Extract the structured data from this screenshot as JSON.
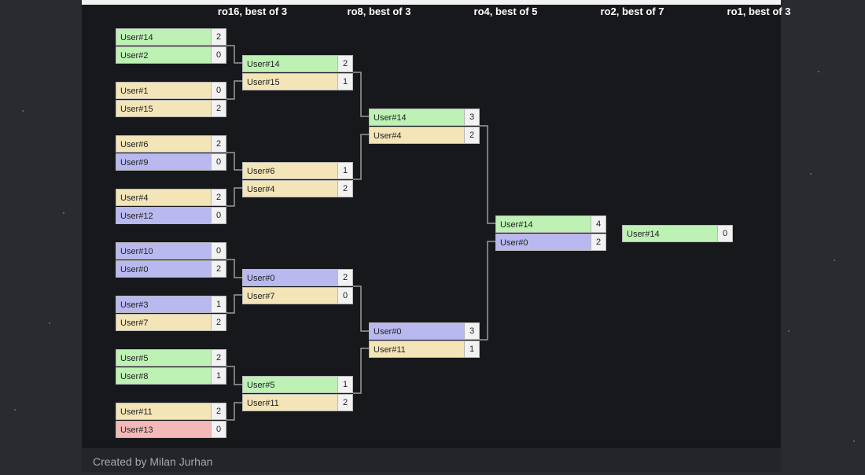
{
  "rounds": [
    {
      "title": "ro16, best of 3"
    },
    {
      "title": "ro8, best of 3"
    },
    {
      "title": "ro4, best of 5"
    },
    {
      "title": "ro2, best of 7"
    },
    {
      "title": "ro1, best of 3"
    }
  ],
  "matches": {
    "r16": [
      {
        "a": {
          "name": "User#14",
          "score": "2",
          "status": "win"
        },
        "b": {
          "name": "User#2",
          "score": "0",
          "status": "win"
        }
      },
      {
        "a": {
          "name": "User#1",
          "score": "0",
          "status": "mid"
        },
        "b": {
          "name": "User#15",
          "score": "2",
          "status": "mid"
        }
      },
      {
        "a": {
          "name": "User#6",
          "score": "2",
          "status": "mid"
        },
        "b": {
          "name": "User#9",
          "score": "0",
          "status": "loss"
        }
      },
      {
        "a": {
          "name": "User#4",
          "score": "2",
          "status": "mid"
        },
        "b": {
          "name": "User#12",
          "score": "0",
          "status": "loss"
        }
      },
      {
        "a": {
          "name": "User#10",
          "score": "0",
          "status": "loss"
        },
        "b": {
          "name": "User#0",
          "score": "2",
          "status": "loss"
        }
      },
      {
        "a": {
          "name": "User#3",
          "score": "1",
          "status": "loss"
        },
        "b": {
          "name": "User#7",
          "score": "2",
          "status": "mid"
        }
      },
      {
        "a": {
          "name": "User#5",
          "score": "2",
          "status": "win"
        },
        "b": {
          "name": "User#8",
          "score": "1",
          "status": "win"
        }
      },
      {
        "a": {
          "name": "User#11",
          "score": "2",
          "status": "mid"
        },
        "b": {
          "name": "User#13",
          "score": "0",
          "status": "elim"
        }
      }
    ],
    "r8": [
      {
        "a": {
          "name": "User#14",
          "score": "2",
          "status": "win"
        },
        "b": {
          "name": "User#15",
          "score": "1",
          "status": "mid"
        }
      },
      {
        "a": {
          "name": "User#6",
          "score": "1",
          "status": "mid"
        },
        "b": {
          "name": "User#4",
          "score": "2",
          "status": "mid"
        }
      },
      {
        "a": {
          "name": "User#0",
          "score": "2",
          "status": "loss"
        },
        "b": {
          "name": "User#7",
          "score": "0",
          "status": "mid"
        }
      },
      {
        "a": {
          "name": "User#5",
          "score": "1",
          "status": "win"
        },
        "b": {
          "name": "User#11",
          "score": "2",
          "status": "mid"
        }
      }
    ],
    "r4": [
      {
        "a": {
          "name": "User#14",
          "score": "3",
          "status": "win"
        },
        "b": {
          "name": "User#4",
          "score": "2",
          "status": "mid"
        }
      },
      {
        "a": {
          "name": "User#0",
          "score": "3",
          "status": "loss"
        },
        "b": {
          "name": "User#11",
          "score": "1",
          "status": "mid"
        }
      }
    ],
    "r2": [
      {
        "a": {
          "name": "User#14",
          "score": "4",
          "status": "win"
        },
        "b": {
          "name": "User#0",
          "score": "2",
          "status": "loss"
        }
      }
    ],
    "r1": {
      "name": "User#14",
      "score": "0",
      "status": "win"
    }
  },
  "status_colors": {
    "win": "#bdf2b4",
    "mid": "#f3e5b8",
    "loss": "#b9b9f0",
    "elim": "#f3b9b9"
  },
  "footer": {
    "credit": "Created by Milan Jurhan"
  }
}
